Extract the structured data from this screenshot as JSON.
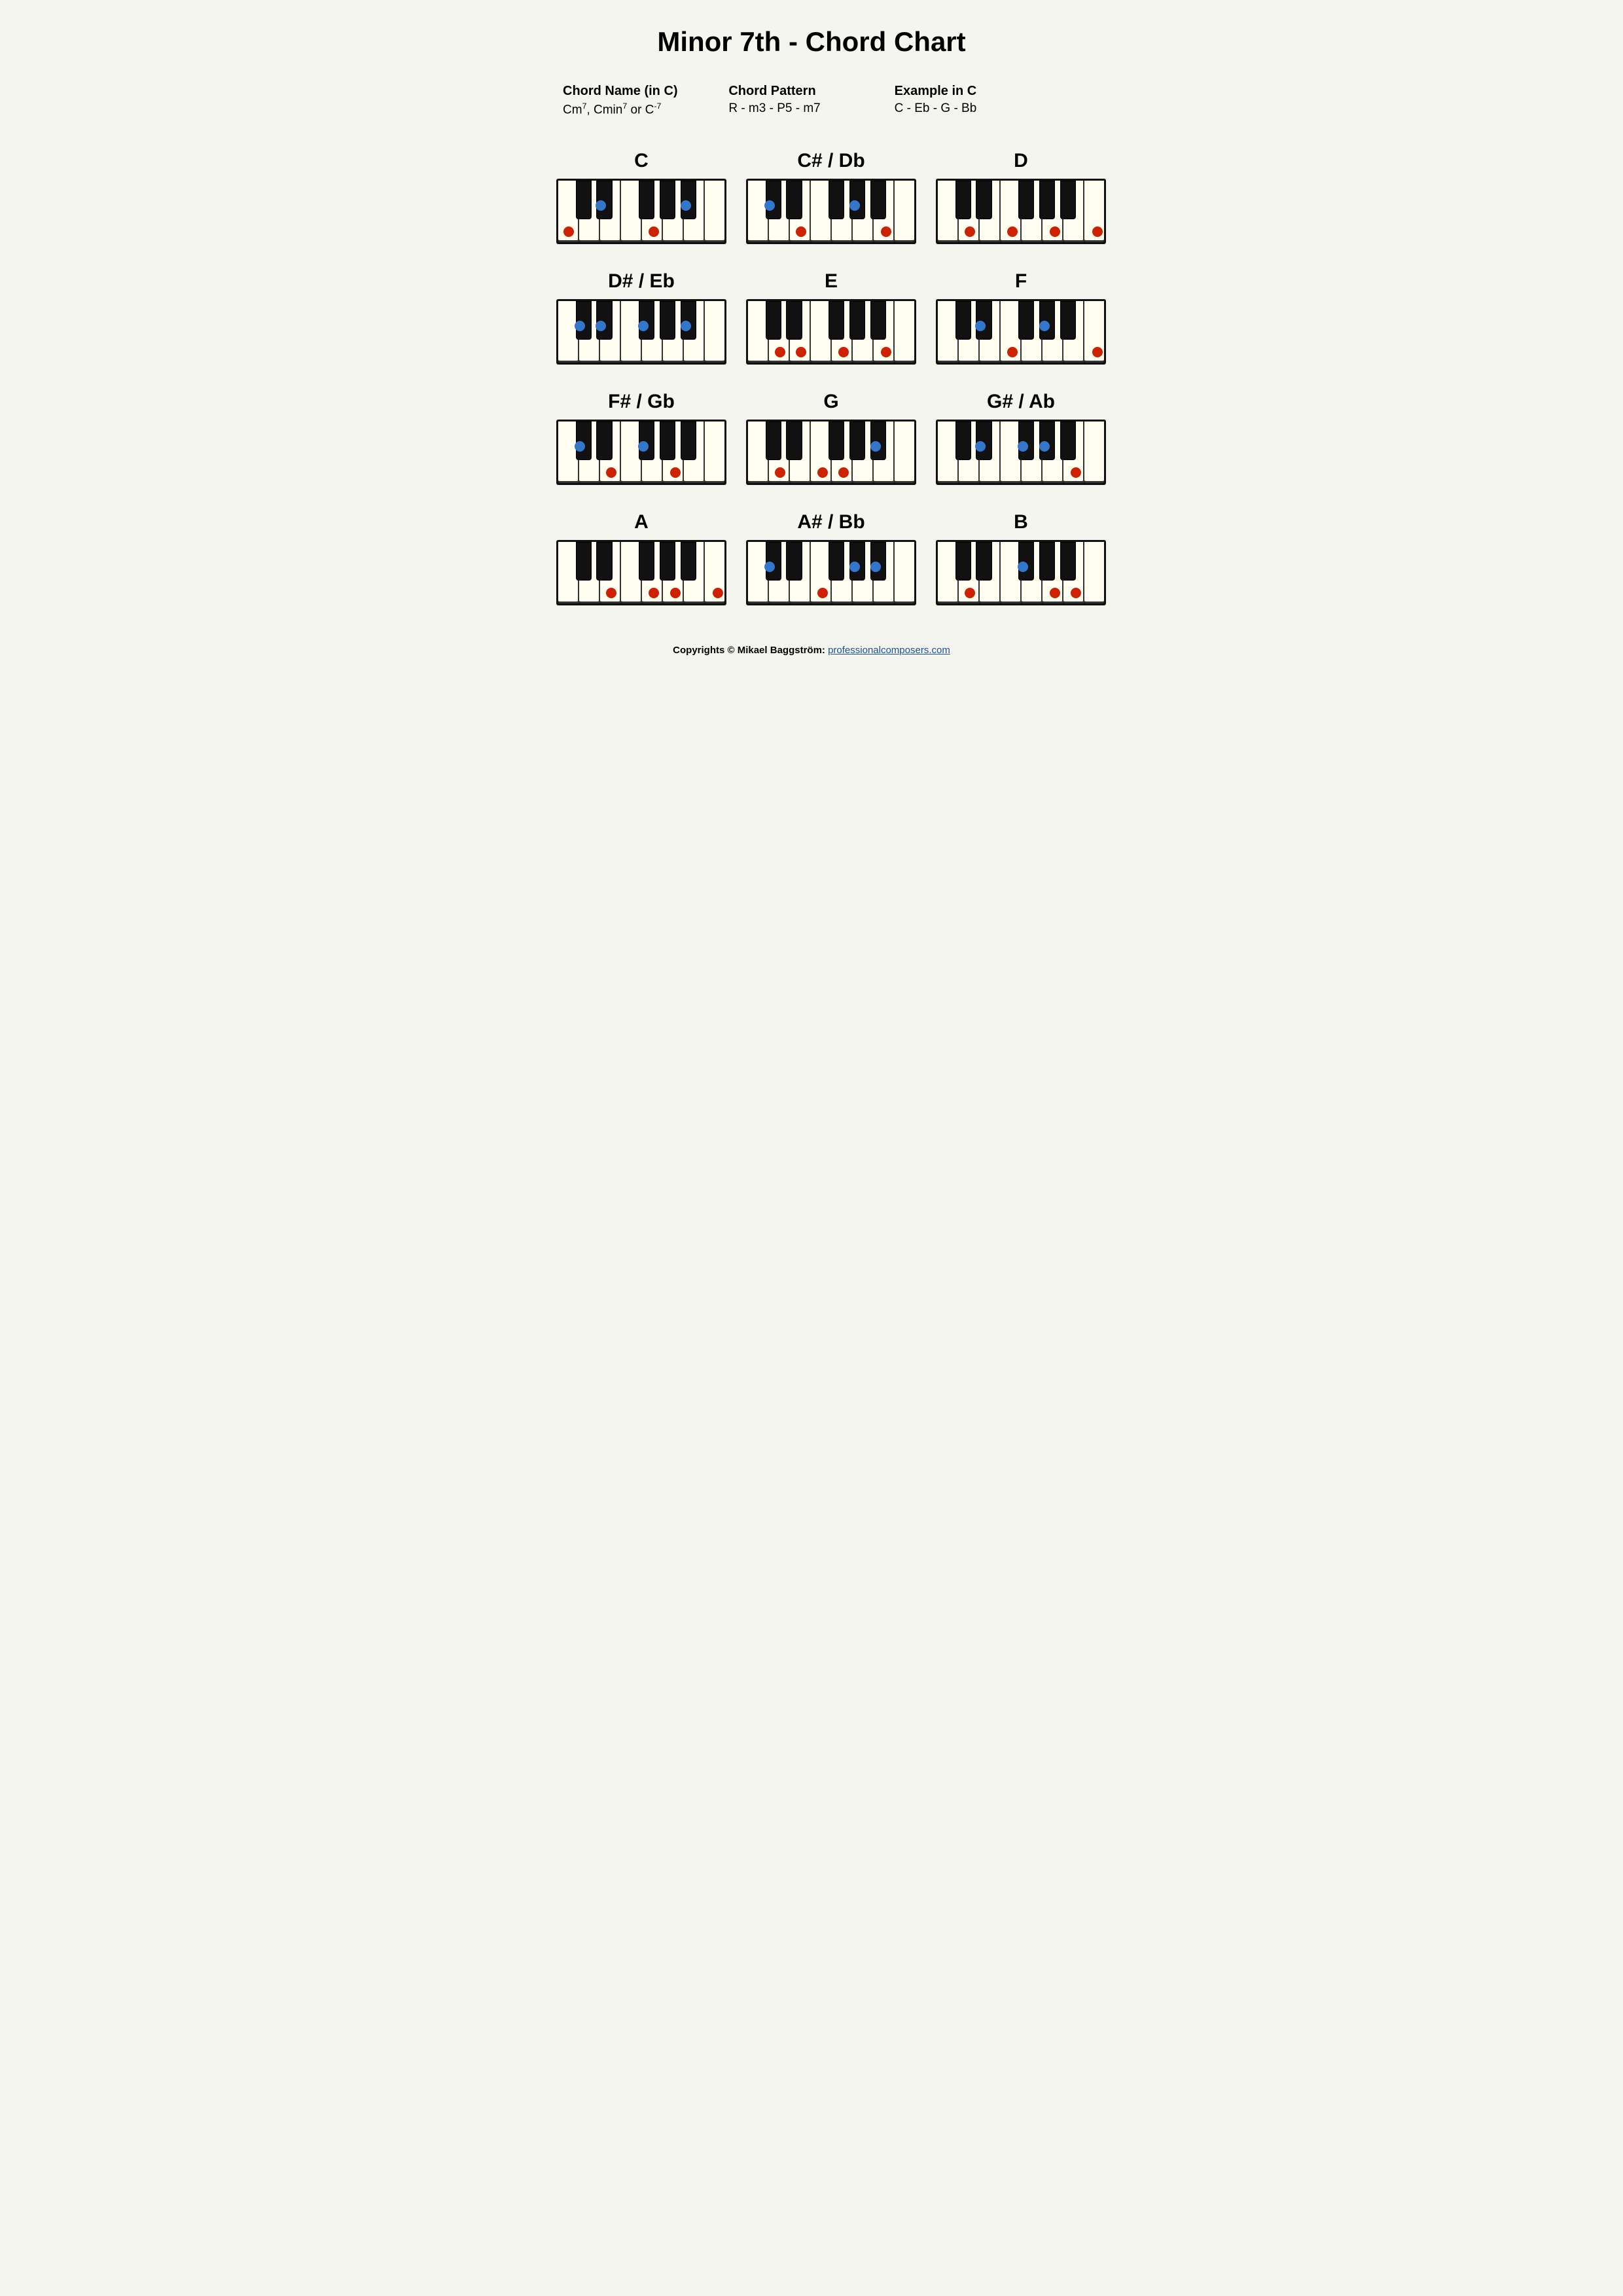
{
  "title": "Minor 7th - Chord Chart",
  "info": {
    "chord_name_label": "Chord Name (in C)",
    "chord_name_value": "Cm⁷, Cmin⁷ or C-⁷",
    "chord_pattern_label": "Chord Pattern",
    "chord_pattern_value": "R - m3 - P5 - m7",
    "example_label": "Example in C",
    "example_value": "C - Eb - G - Bb"
  },
  "chords": [
    {
      "name": "C",
      "id": "C"
    },
    {
      "name": "C# / Db",
      "id": "Cs"
    },
    {
      "name": "D",
      "id": "D"
    },
    {
      "name": "D# / Eb",
      "id": "Ds"
    },
    {
      "name": "E",
      "id": "E"
    },
    {
      "name": "F",
      "id": "F"
    },
    {
      "name": "F# / Gb",
      "id": "Fs"
    },
    {
      "name": "G",
      "id": "G"
    },
    {
      "name": "G# / Ab",
      "id": "Gs"
    },
    {
      "name": "A",
      "id": "A"
    },
    {
      "name": "A# / Bb",
      "id": "As"
    },
    {
      "name": "B",
      "id": "B"
    }
  ],
  "footer_text": "Copyrights © Mikael Baggström: ",
  "footer_link_text": "professionalcomposers.com",
  "footer_link_url": "https://professionalcomposers.com"
}
